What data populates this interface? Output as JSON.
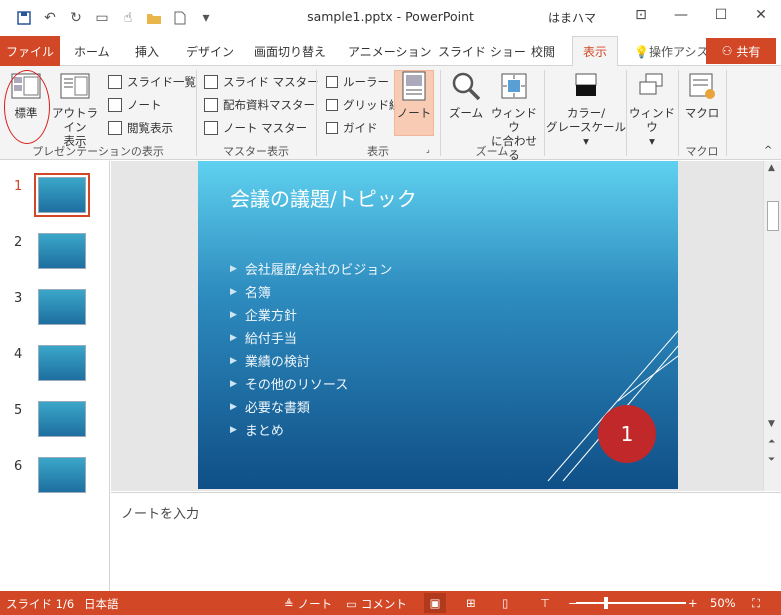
{
  "title": "sample1.pptx  -  PowerPoint",
  "user": "はまハマ",
  "tabs": {
    "file": "ファイル",
    "home": "ホーム",
    "insert": "挿入",
    "design": "デザイン",
    "transitions": "画面切り替え",
    "animations": "アニメーション",
    "slideshow": "スライド ショー",
    "review": "校閲",
    "view": "表示",
    "tellme": "操作アシス",
    "share": "共有"
  },
  "ribbon": {
    "presentation_views": {
      "label": "プレゼンテーションの表示",
      "normal": "標準",
      "outline": [
        "アウトライン",
        "表示"
      ],
      "slide_sorter": "スライド一覧",
      "notes_page": "ノート",
      "reading_view": "閲覧表示"
    },
    "master_views": {
      "label": "マスター表示",
      "slide_master": "スライド マスター",
      "handout_master": "配布資料マスター",
      "notes_master": "ノート マスター"
    },
    "show": {
      "label": "表示",
      "ruler": "ルーラー",
      "gridlines": "グリッド線",
      "guides": "ガイド",
      "notes": "ノート"
    },
    "zoom": {
      "label": "ズーム",
      "zoom": "ズーム",
      "fit": [
        "ウィンドウ",
        "に合わせる"
      ]
    },
    "color": {
      "label": [
        "カラー/",
        "グレースケール"
      ]
    },
    "window": {
      "label": "ウィンドウ"
    },
    "macros": {
      "label": "マクロ",
      "macros": "マクロ"
    }
  },
  "thumbnails": [
    "1",
    "2",
    "3",
    "4",
    "5",
    "6"
  ],
  "slide": {
    "title": "会議の議題/トピック",
    "bullets": [
      "会社履歴/会社のビジョン",
      "名簿",
      "企業方針",
      "給付手当",
      "業績の検討",
      "その他のリソース",
      "必要な書類",
      "まとめ"
    ],
    "badge": "1"
  },
  "notes_placeholder": "ノートを入力",
  "status": {
    "slide": "スライド 1/6",
    "language": "日本語",
    "notes": "ノート",
    "comments": "コメント",
    "zoom": "50%"
  },
  "colors": {
    "accent": "#d24726",
    "annotation_ring": "#d81e1e"
  }
}
